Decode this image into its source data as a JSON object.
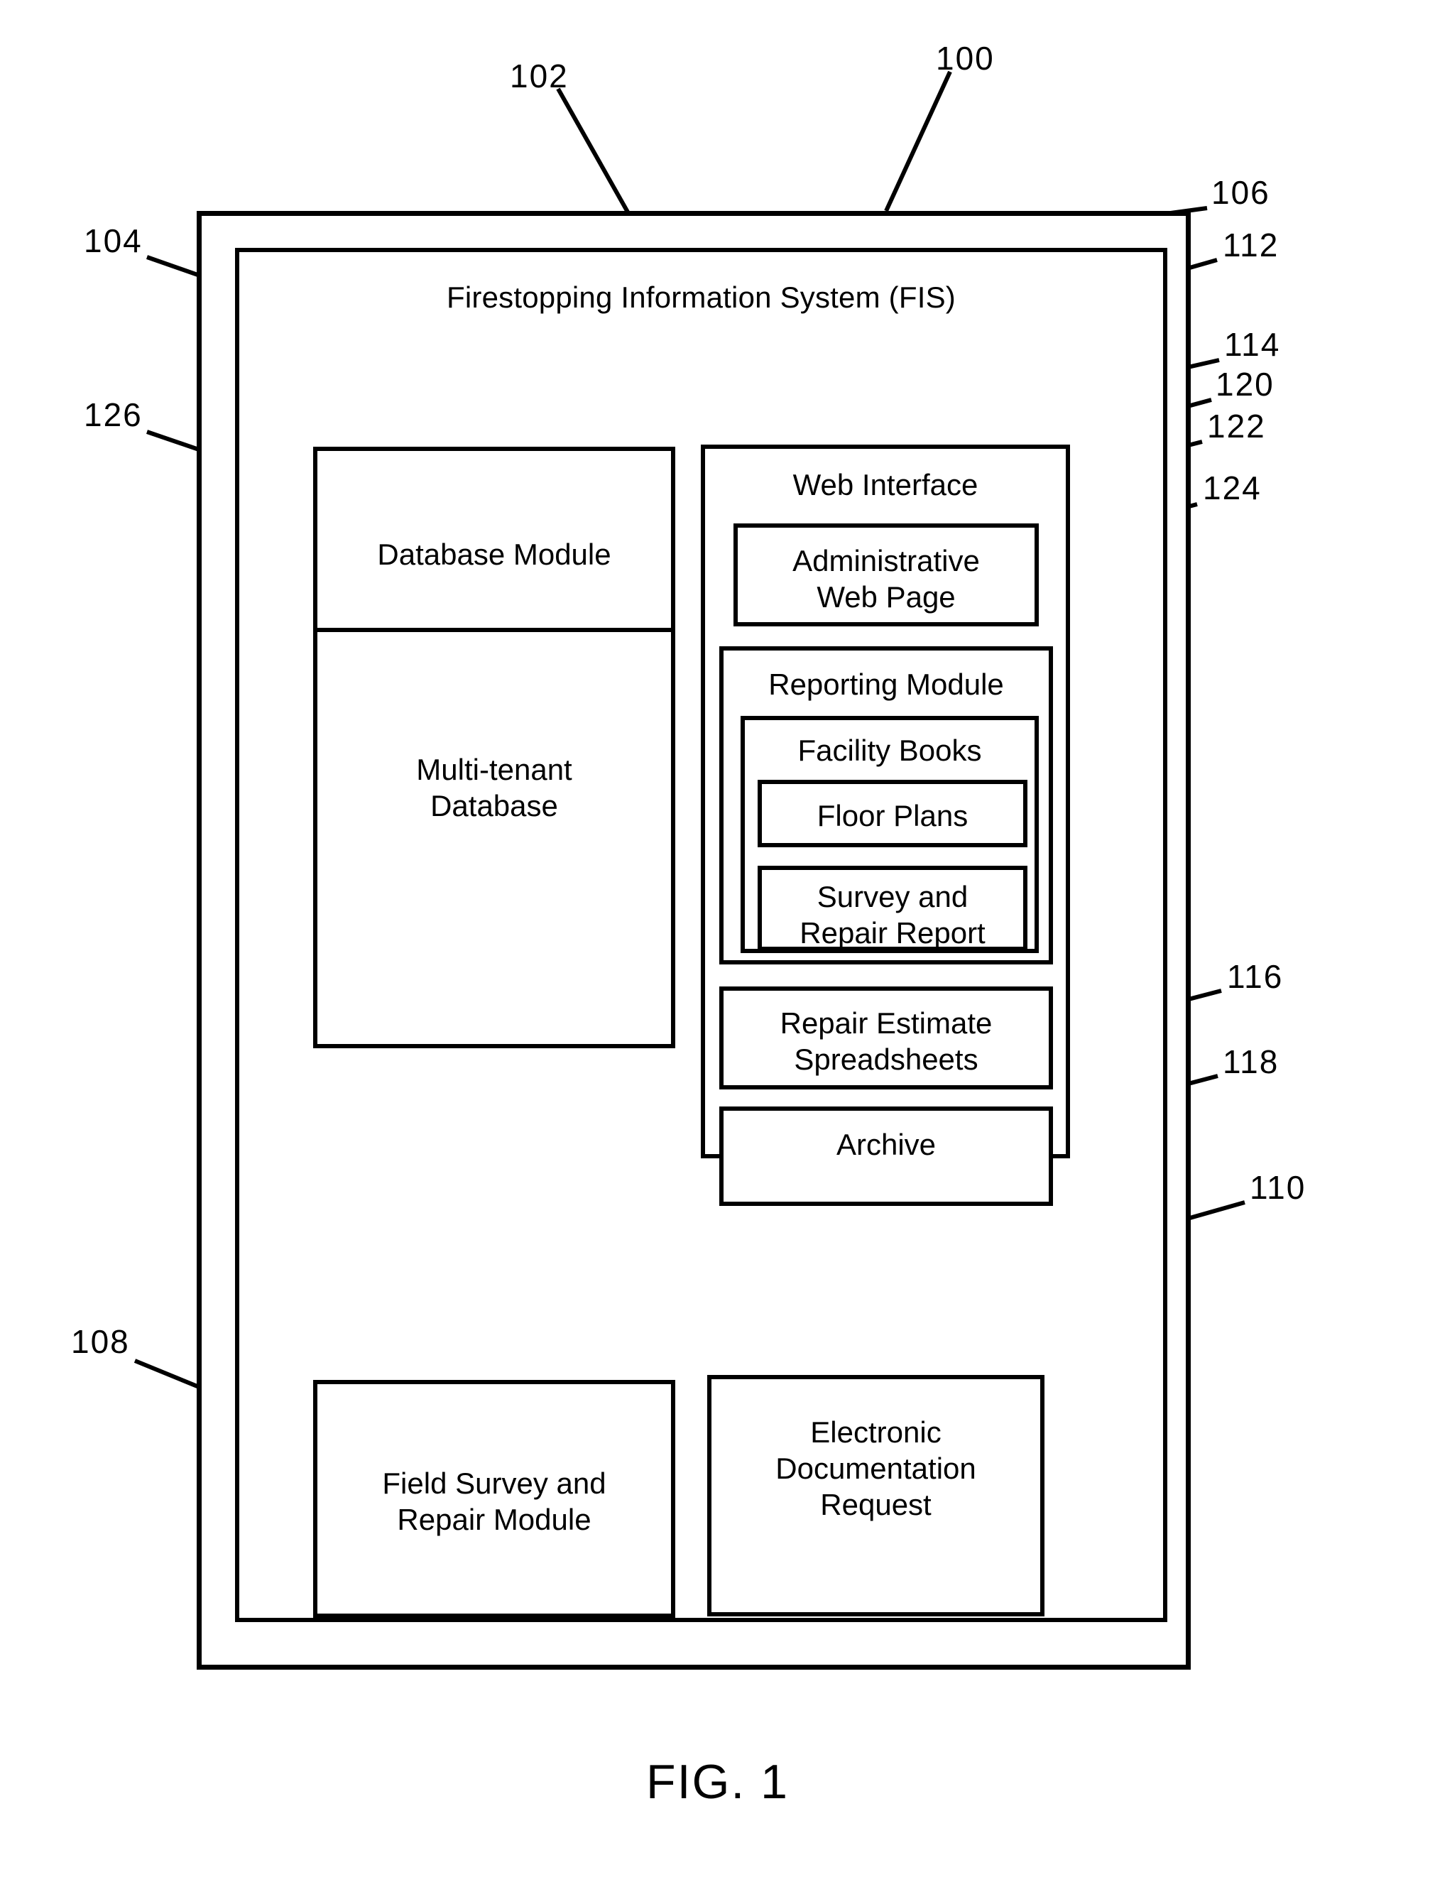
{
  "figure": {
    "caption": "FIG. 1",
    "title": "Firestopping Information System (FIS)"
  },
  "boxes": {
    "system_boundary": {
      "label": "",
      "ref": "100"
    },
    "fis_boundary": {
      "label": "Firestopping Information System (FIS)",
      "ref": "102"
    },
    "database_module": {
      "label": "Database Module",
      "ref": "104"
    },
    "multi_tenant_database": {
      "label": "Multi-tenant\nDatabase",
      "ref": "126"
    },
    "field_survey_repair_module": {
      "label": "Field Survey and\nRepair Module",
      "ref": "108"
    },
    "web_interface": {
      "label": "Web Interface",
      "ref": "106"
    },
    "administrative_web_page": {
      "label": "Administrative\nWeb Page",
      "ref": "112"
    },
    "reporting_module": {
      "label": "Reporting Module",
      "ref": "114"
    },
    "facility_books": {
      "label": "Facility Books",
      "ref": "120"
    },
    "floor_plans": {
      "label": "Floor Plans",
      "ref": "122"
    },
    "survey_and_repair_report": {
      "label": "Survey and\nRepair Report",
      "ref": "124"
    },
    "repair_estimate_spreadsheets": {
      "label": "Repair Estimate\nSpreadsheets",
      "ref": "116"
    },
    "archive": {
      "label": "Archive",
      "ref": "118"
    },
    "electronic_documentation_request": {
      "label": "Electronic\nDocumentation\nRequest",
      "ref": "110"
    }
  },
  "reference_numerals": [
    {
      "id": "100",
      "value": "100"
    },
    {
      "id": "102",
      "value": "102"
    },
    {
      "id": "104",
      "value": "104"
    },
    {
      "id": "106",
      "value": "106"
    },
    {
      "id": "108",
      "value": "108"
    },
    {
      "id": "110",
      "value": "110"
    },
    {
      "id": "112",
      "value": "112"
    },
    {
      "id": "114",
      "value": "114"
    },
    {
      "id": "116",
      "value": "116"
    },
    {
      "id": "118",
      "value": "118"
    },
    {
      "id": "120",
      "value": "120"
    },
    {
      "id": "122",
      "value": "122"
    },
    {
      "id": "124",
      "value": "124"
    },
    {
      "id": "126",
      "value": "126"
    }
  ],
  "colors": {
    "stroke": "#000000",
    "background": "#ffffff"
  }
}
